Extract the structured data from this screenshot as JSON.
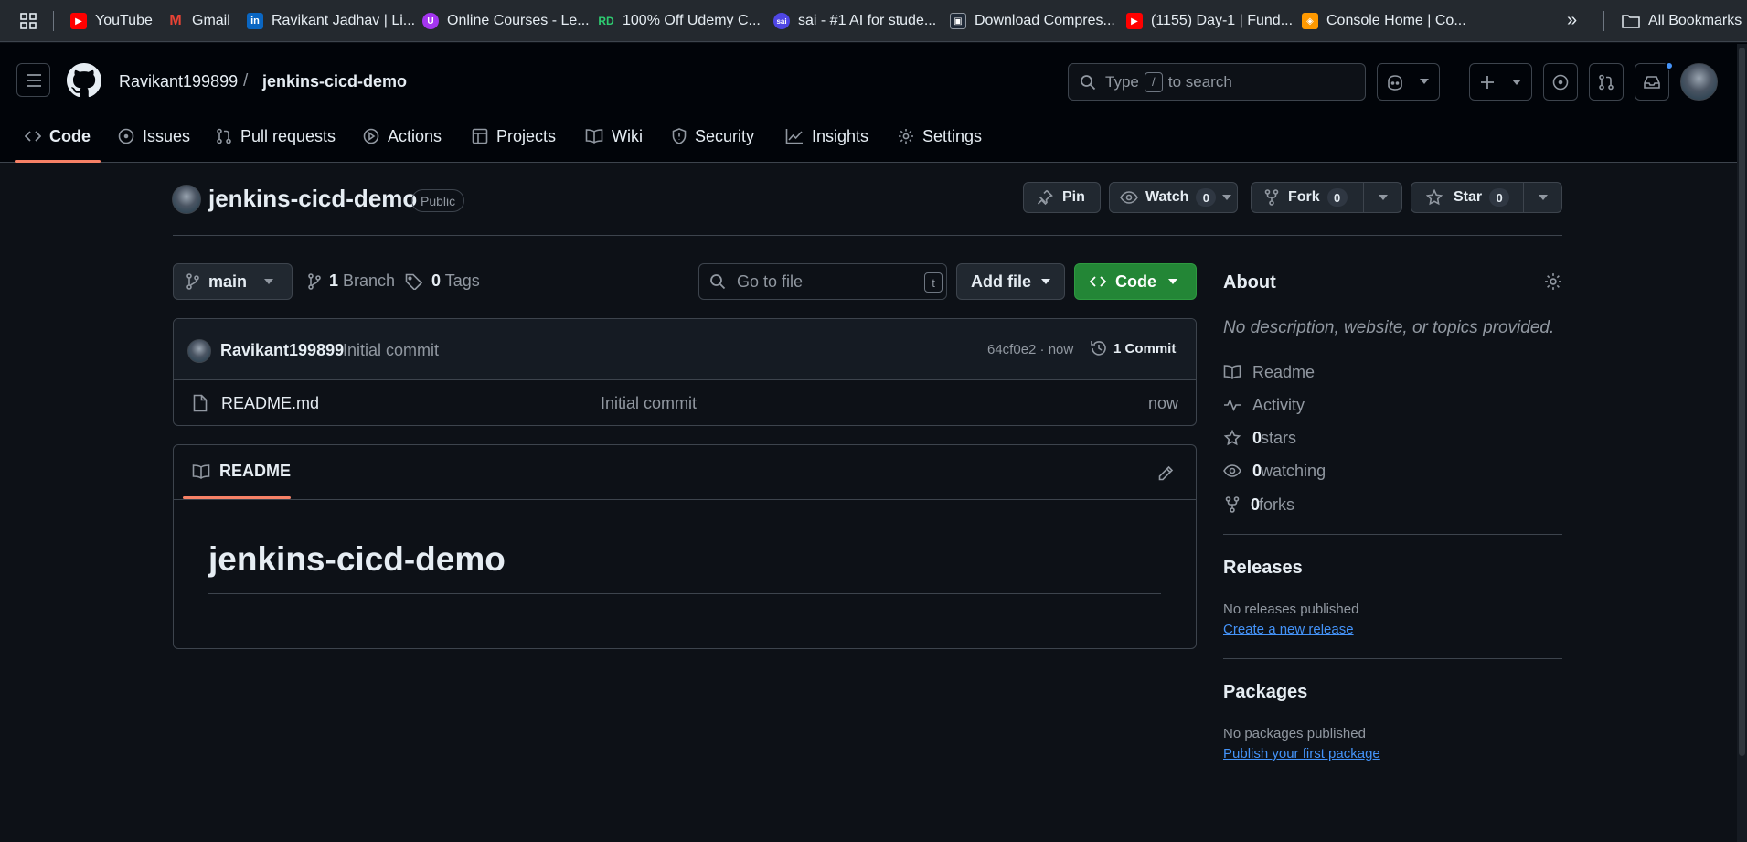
{
  "bookmarks": {
    "items": [
      {
        "label": "YouTube",
        "icon": "youtube-icon",
        "color": "#ff0000"
      },
      {
        "label": "Gmail",
        "icon": "gmail-icon",
        "color": "#ea4335"
      },
      {
        "label": "Ravikant Jadhav | Li...",
        "icon": "linkedin-icon",
        "color": "#0a66c2"
      },
      {
        "label": "Online Courses - Le...",
        "icon": "udemy-icon",
        "color": "#a435f0"
      },
      {
        "label": "100% Off Udemy C...",
        "icon": "rd-icon",
        "color": "#2ecc71"
      },
      {
        "label": "sai - #1 AI for stude...",
        "icon": "sai-icon",
        "color": "#4f46e5"
      },
      {
        "label": "Download Compres...",
        "icon": "image-icon",
        "color": "#1f6feb"
      },
      {
        "label": "(1155) Day-1 | Fund...",
        "icon": "youtube-icon",
        "color": "#ff0000"
      },
      {
        "label": "Console Home | Co...",
        "icon": "aws-icon",
        "color": "#ff9900"
      }
    ],
    "more": "»",
    "all_bookmarks": "All Bookmarks"
  },
  "header": {
    "owner": "Ravikant199899",
    "slash": "/",
    "repo": "jenkins-cicd-demo",
    "search_prefix": "Type",
    "search_key": "/",
    "search_suffix": "to search"
  },
  "tabs": [
    {
      "label": "Code",
      "icon": "code-icon",
      "active": true
    },
    {
      "label": "Issues",
      "icon": "issue-icon"
    },
    {
      "label": "Pull requests",
      "icon": "pull-request-icon"
    },
    {
      "label": "Actions",
      "icon": "play-icon"
    },
    {
      "label": "Projects",
      "icon": "table-icon"
    },
    {
      "label": "Wiki",
      "icon": "book-icon"
    },
    {
      "label": "Security",
      "icon": "shield-icon"
    },
    {
      "label": "Insights",
      "icon": "graph-icon"
    },
    {
      "label": "Settings",
      "icon": "gear-icon"
    }
  ],
  "repo": {
    "name": "jenkins-cicd-demo",
    "visibility": "Public",
    "pin": "Pin",
    "watch": "Watch",
    "watch_count": "0",
    "fork": "Fork",
    "fork_count": "0",
    "star": "Star",
    "star_count": "0"
  },
  "toolbar": {
    "branch": "main",
    "branches_count": "1",
    "branches_label": "Branch",
    "tags_count": "0",
    "tags_label": "Tags",
    "go_to_file": "Go to file",
    "go_to_file_key": "t",
    "add_file": "Add file",
    "code": "Code"
  },
  "commit": {
    "author": "Ravikant199899",
    "message": "Initial commit",
    "hash": "64cf0e2 · now",
    "commits": "1 Commit"
  },
  "files": [
    {
      "name": "README.md",
      "message": "Initial commit",
      "time": "now"
    }
  ],
  "readme": {
    "tab": "README",
    "heading": "jenkins-cicd-demo"
  },
  "about": {
    "title": "About",
    "description": "No description, website, or topics provided.",
    "readme": "Readme",
    "activity": "Activity",
    "stars_count": "0",
    "stars": "stars",
    "watching_count": "0",
    "watching": "watching",
    "forks_count": "0",
    "forks": "forks"
  },
  "releases": {
    "title": "Releases",
    "none": "No releases published",
    "link": "Create a new release"
  },
  "packages": {
    "title": "Packages",
    "none": "No packages published",
    "link": "Publish your first package"
  },
  "colors": {
    "accent_green": "#238636",
    "tab_underline": "#f78166",
    "link": "#4493f8",
    "notification_dot": "#4493f8"
  }
}
